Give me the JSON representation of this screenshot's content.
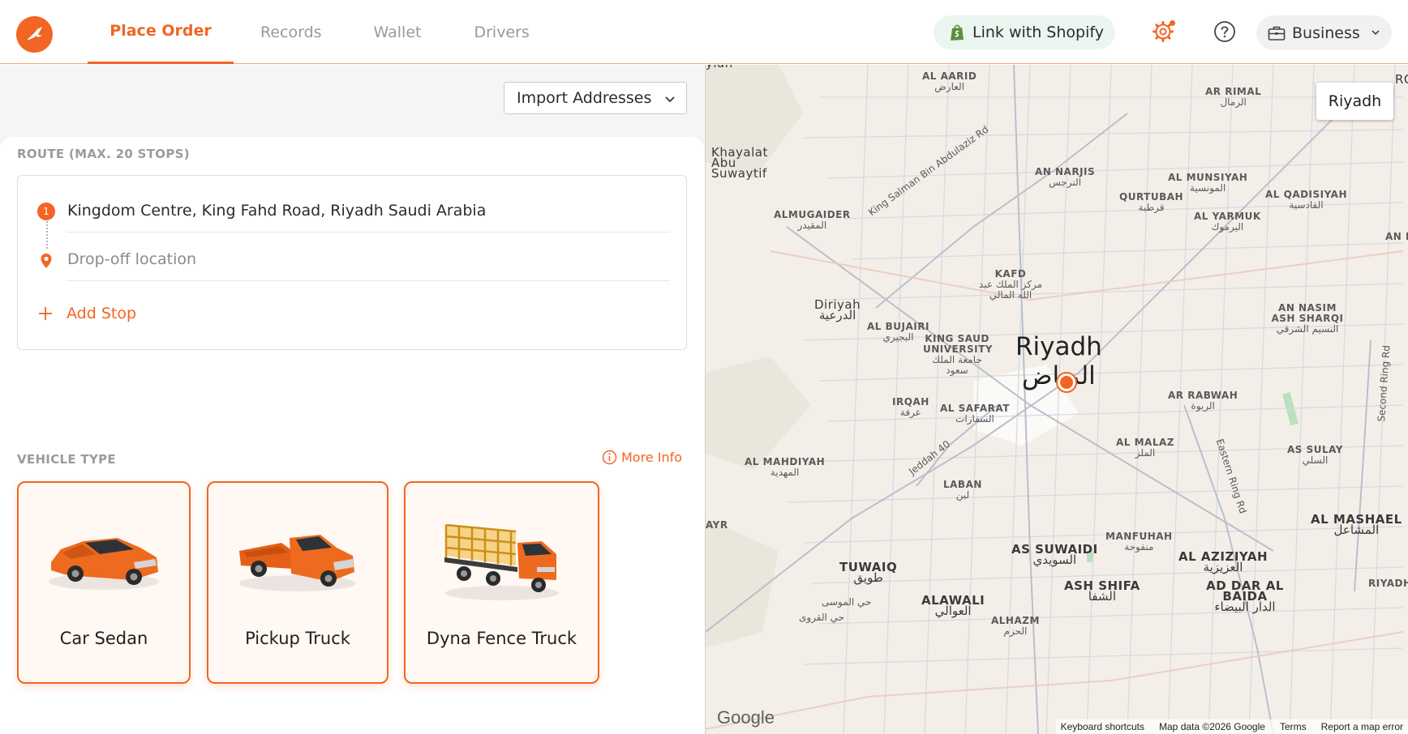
{
  "colors": {
    "accent": "#f26522",
    "shopify_bg": "#eaf6ef",
    "map_bg": "#f3efe8"
  },
  "nav": {
    "items": [
      {
        "label": "Place Order",
        "active": true
      },
      {
        "label": "Records"
      },
      {
        "label": "Wallet"
      },
      {
        "label": "Drivers"
      }
    ]
  },
  "header": {
    "shopify_label": "Link with Shopify",
    "account_label": "Business",
    "icons": [
      "bird-logo-icon",
      "shopify-bag-icon",
      "gear-icon",
      "help-icon",
      "briefcase-icon",
      "chevron-down-icon"
    ]
  },
  "route": {
    "import_label": "Import Addresses",
    "section_label": "ROUTE (MAX. 20 STOPS)",
    "stops": [
      {
        "number": "1",
        "value": "Kingdom Centre, King Fahd Road, Riyadh Saudi Arabia"
      },
      {
        "placeholder": "Drop-off location"
      }
    ],
    "add_stop_label": "Add Stop"
  },
  "vehicle": {
    "section_label": "VEHICLE TYPE",
    "more_info_label": "More Info",
    "types": [
      {
        "name": "Car Sedan"
      },
      {
        "name": "Pickup Truck"
      },
      {
        "name": "Dyna Fence Truck"
      }
    ]
  },
  "map": {
    "city_button": "Riyadh",
    "city_en": "Riyadh",
    "city_ar": "الرياض",
    "labels": {
      "al_aarid": "AL AARID",
      "al_aarid_ar": "العارض",
      "ar_rimal": "AR RIMAL",
      "ar_rimal_ar": "الرمال",
      "khayalat": "Khayalat Abu Suwaytif",
      "an_narjis": "AN NARJIS",
      "an_narjis_ar": "النرجس",
      "al_munsiyah": "AL MUNSIYAH",
      "al_munsiyah_ar": "المونسية",
      "al_qadisiyah": "AL QADISIYAH",
      "al_qadisiyah_ar": "القادسية",
      "qurtubah": "QURTUBAH",
      "qurtubah_ar": "قرطبة",
      "al_yarmuk": "AL YARMUK",
      "al_yarmuk_ar": "اليرموك",
      "almugaider": "ALMUGAIDER",
      "almugaider_ar": "المقيدر",
      "an_n": "AN N",
      "kafd": "KAFD",
      "kafd_ar": "مركز الملك عبد الله المالي",
      "diriyah": "Diriyah",
      "diriyah_ar": "الدرعية",
      "al_bujairi": "AL BUJAIRI",
      "al_bujairi_ar": "البجيري",
      "king_saud": "KING SAUD UNIVERSITY",
      "king_saud_ar": "جامعة الملك سعود",
      "an_nasim": "AN NASIM ASH SHARQI",
      "an_nasim_ar": "النسيم الشرقي",
      "irqah": "IRQAH",
      "irqah_ar": "عرقة",
      "al_safarat": "AL SAFARAT",
      "al_safarat_ar": "السفارات",
      "ar_rabwah": "AR RABWAH",
      "ar_rabwah_ar": "الربوة",
      "al_malaz": "AL MALAZ",
      "al_malaz_ar": "الملز",
      "as_sulay": "AS SULAY",
      "as_sulay_ar": "السلي",
      "al_mahdiyah": "AL MAHDIYAH",
      "al_mahdiyah_ar": "المهدية",
      "laban": "LABAN",
      "laban_ar": "لبن",
      "manfuhah": "MANFUHAH",
      "manfuhah_ar": "منفوحة",
      "al_mashael": "AL MASHAEL",
      "al_mashael_ar": "المشاعل",
      "as_suwaidi": "AS SUWAIDI",
      "as_suwaidi_ar": "السويدي",
      "al_aziziyah": "AL AZIZIYAH",
      "al_aziziyah_ar": "العزيزية",
      "tuwaiq": "TUWAIQ",
      "tuwaiq_ar": "طويق",
      "ash_shifa": "ASH SHIFA",
      "ash_shifa_ar": "الشفا",
      "ad_dar": "AD DAR AL BAIDA",
      "ad_dar_ar": "الدار البيضاء",
      "riyadh_industrial": "RIYADH INDUSTR",
      "alawali": "ALAWALI",
      "alawali_ar": "العوالي",
      "alhazm": "ALHAZM",
      "alhazm_ar": "الحزم",
      "hay_almousa": "حي الموسى",
      "hay_alqurawi": "حي القروى",
      "ylah": "ylah",
      "rq": "RQ",
      "ayr": "AYR"
    },
    "roads": {
      "king_salman": "King Salman Bin Abdulaziz Rd",
      "jeddah": "Jeddah 40",
      "eastern_ring": "Eastern Ring Rd",
      "second_ring": "Second Ring Rd"
    },
    "attribution": {
      "logo": "Google",
      "shortcuts": "Keyboard shortcuts",
      "map_data": "Map data ©2026 Google",
      "terms": "Terms",
      "report": "Report a map error"
    }
  }
}
